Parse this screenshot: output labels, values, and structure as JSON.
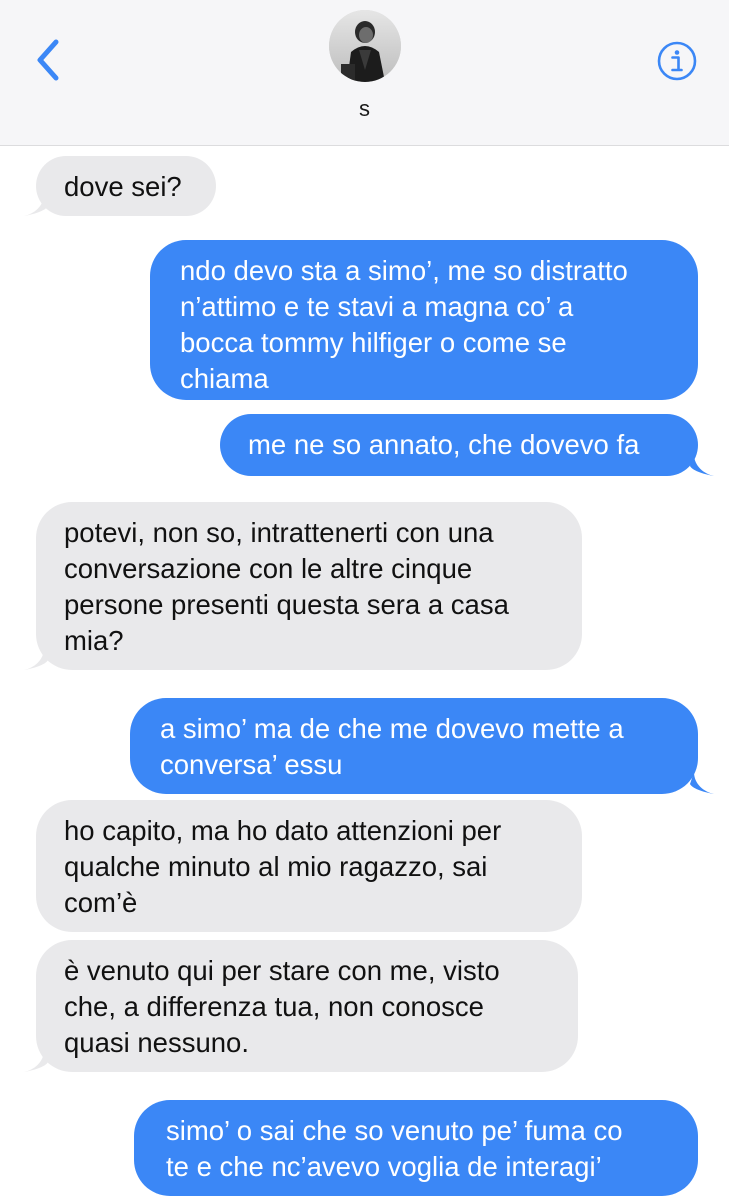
{
  "contact": {
    "name": "s"
  },
  "header": {
    "back_icon": "chevron-left-icon",
    "info_icon": "info-circle-icon",
    "accent_color": "#3b87f6"
  },
  "messages": [
    {
      "direction": "received",
      "text": "dove sei?"
    },
    {
      "direction": "sent",
      "text": "ndo devo sta a simo’, me so distratto\nn’attimo e te stavi a magna co’ a\nbocca tommy hilfiger o come se\nchiama"
    },
    {
      "direction": "sent",
      "text": "me ne so annato, che dovevo fa"
    },
    {
      "direction": "received",
      "text": "potevi, non so, intrattenerti con una\nconversazione con le altre cinque\npersone presenti questa sera a casa\nmia?"
    },
    {
      "direction": "sent",
      "text": "a simo’ ma de che me dovevo mette a\nconversa’ essu"
    },
    {
      "direction": "received",
      "text": "ho capito, ma ho dato attenzioni per\nqualche minuto al mio ragazzo, sai\ncom’è"
    },
    {
      "direction": "received",
      "text": "è venuto qui per stare con me, visto\nche, a differenza tua, non conosce\nquasi nessuno."
    },
    {
      "direction": "sent",
      "text": "simo’ o sai che so venuto pe’ fuma co\nte e che nc’avevo voglia de interagi’"
    }
  ],
  "colors": {
    "sent_bubble": "#3b87f6",
    "received_bubble": "#e9e9eb",
    "header_bg": "#f6f6f8"
  }
}
